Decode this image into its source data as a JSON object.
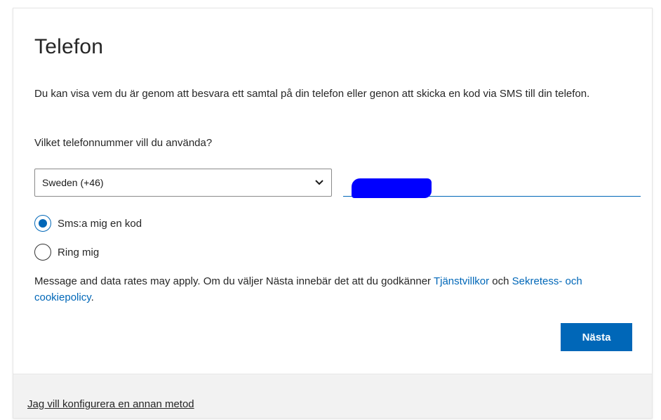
{
  "card": {
    "title": "Telefon",
    "description": "Du kan visa vem du är genom att besvara ett samtal på din telefon eller genon att skicka en kod via SMS till din telefon.",
    "question": "Vilket telefonnummer vill du använda?"
  },
  "country_select": {
    "selected": "Sweden (+46)",
    "icon": "chevron-down-icon"
  },
  "phone_input": {
    "value": ""
  },
  "radio_options": [
    {
      "label": "Sms:a mig en kod",
      "checked": true
    },
    {
      "label": "Ring mig",
      "checked": false
    }
  ],
  "legal": {
    "text_before": "Message and data rates may apply. Om du väljer Nästa innebär det att du godkänner ",
    "terms_link": "Tjänstvillkor",
    "text_middle": " och ",
    "privacy_link": "Sekretess- och cookiepolicy",
    "text_after": "."
  },
  "actions": {
    "next_label": "Nästa"
  },
  "footer": {
    "alt_method_link": "Jag vill konfigurera en annan metod"
  },
  "colors": {
    "accent": "#0067b8",
    "redaction": "#0000ff",
    "footer_bg": "#f2f2f2"
  }
}
